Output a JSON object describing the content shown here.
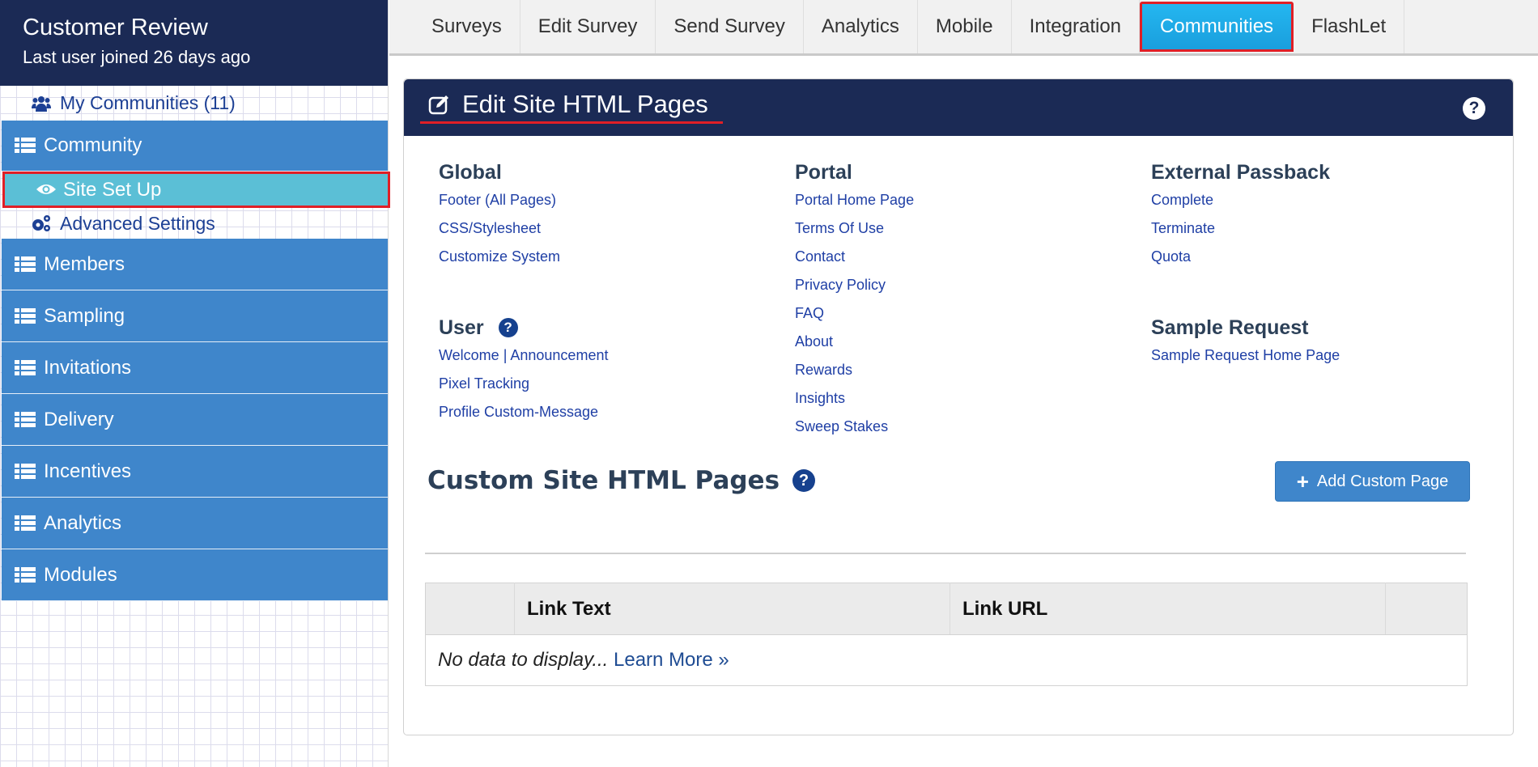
{
  "sidebar": {
    "title": "Customer Review",
    "subtitle": "Last user joined 26 days ago",
    "my_communities": "My Communities (11)",
    "sections": [
      {
        "label": "Community",
        "icon": "list-icon"
      },
      {
        "label": "Members",
        "icon": "list-icon"
      },
      {
        "label": "Sampling",
        "icon": "list-icon"
      },
      {
        "label": "Invitations",
        "icon": "list-icon"
      },
      {
        "label": "Delivery",
        "icon": "list-icon"
      },
      {
        "label": "Incentives",
        "icon": "list-icon"
      },
      {
        "label": "Analytics",
        "icon": "list-icon"
      },
      {
        "label": "Modules",
        "icon": "list-icon"
      }
    ],
    "sub_items": [
      {
        "label": "Site Set Up",
        "icon": "eye-icon",
        "active": true
      },
      {
        "label": "Advanced Settings",
        "icon": "gears-icon",
        "active": false
      }
    ]
  },
  "tabs": [
    {
      "label": "Surveys"
    },
    {
      "label": "Edit Survey"
    },
    {
      "label": "Send Survey"
    },
    {
      "label": "Analytics"
    },
    {
      "label": "Mobile"
    },
    {
      "label": "Integration"
    },
    {
      "label": "Communities",
      "active": true
    },
    {
      "label": "FlashLet"
    }
  ],
  "panel": {
    "title": "Edit Site HTML Pages",
    "help": "?",
    "groups": {
      "global": {
        "heading": "Global",
        "links": [
          "Footer (All Pages)",
          "CSS/Stylesheet",
          "Customize System"
        ]
      },
      "user": {
        "heading": "User",
        "links": [
          "Welcome | Announcement",
          "Pixel Tracking",
          "Profile Custom-Message"
        ]
      },
      "portal": {
        "heading": "Portal",
        "links": [
          "Portal Home Page",
          "Terms Of Use",
          "Contact",
          "Privacy Policy",
          "FAQ",
          "About",
          "Rewards",
          "Insights",
          "Sweep Stakes"
        ]
      },
      "external": {
        "heading": "External Passback",
        "links": [
          "Complete",
          "Terminate",
          "Quota"
        ]
      },
      "sample": {
        "heading": "Sample Request",
        "links": [
          "Sample Request Home Page"
        ]
      }
    },
    "custom": {
      "title": "Custom Site HTML Pages",
      "add_button": "Add Custom Page",
      "table": {
        "columns": [
          "",
          "Link Text",
          "Link URL",
          ""
        ],
        "empty_text": "No data to display...",
        "learn_more": "Learn More »"
      }
    }
  },
  "colors": {
    "navy": "#1b2a55",
    "section_blue": "#3f86cb",
    "active_teal": "#5bbfd6",
    "active_tab": "#1fabe8",
    "highlight_red": "#e01f26",
    "link_blue": "#1f3fa5"
  }
}
